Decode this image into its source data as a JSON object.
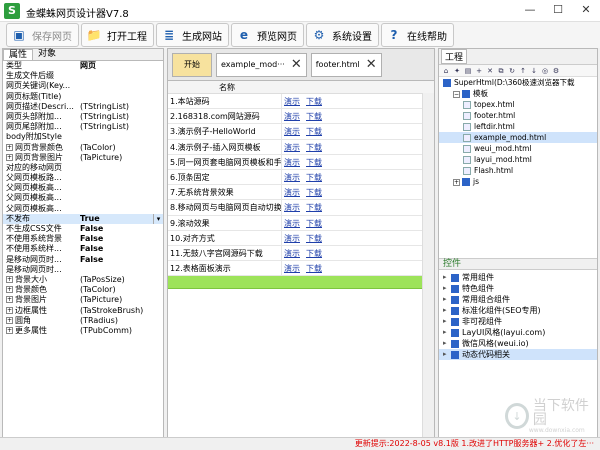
{
  "window": {
    "logo": "S",
    "title": "金蝶蛛网页设计器V7.8"
  },
  "toolbar": [
    {
      "label": "保存网页",
      "icon": "save-icon",
      "disabled": true
    },
    {
      "label": "打开工程",
      "icon": "open-folder-icon"
    },
    {
      "label": "生成网站",
      "icon": "stack-icon"
    },
    {
      "label": "预览网页",
      "icon": "ie-icon"
    },
    {
      "label": "系统设置",
      "icon": "gear-icon"
    },
    {
      "label": "在线帮助",
      "icon": "help-icon"
    }
  ],
  "left": {
    "tabs": [
      "属性",
      "对象"
    ],
    "props": [
      {
        "n": "类型",
        "v": "网页",
        "b": true
      },
      {
        "n": "生成文件后缀",
        "v": ""
      },
      {
        "n": "网页关键词(Key...",
        "v": ""
      },
      {
        "n": "网页标题(Title)",
        "v": ""
      },
      {
        "n": "网页描述(Descri...",
        "v": "(TStringList)"
      },
      {
        "n": "网页头部附加...",
        "v": "(TStringList)"
      },
      {
        "n": "网页尾部附加...",
        "v": "(TStringList)"
      },
      {
        "n": "body附加Style",
        "v": ""
      },
      {
        "n": "网页背景颜色",
        "v": "(TaColor)",
        "e": true
      },
      {
        "n": "网页背景图片",
        "v": "(TaPicture)",
        "e": true
      },
      {
        "n": "对应的移动网页",
        "v": ""
      },
      {
        "n": "父网页模板路...",
        "v": ""
      },
      {
        "n": "父网页模板高...",
        "v": ""
      },
      {
        "n": "父网页模板高...",
        "v": ""
      },
      {
        "n": "父网页模板高...",
        "v": ""
      },
      {
        "n": "不发布",
        "v": "True",
        "b": true,
        "sel": true,
        "dd": true
      },
      {
        "n": "不生成CSS文件",
        "v": "False",
        "b": true
      },
      {
        "n": "不使用系统背景",
        "v": "False",
        "b": true
      },
      {
        "n": "不使用系统样...",
        "v": "False",
        "b": true
      },
      {
        "n": "是移动网页时...",
        "v": "False",
        "b": true
      },
      {
        "n": "是移动网页时...",
        "v": ""
      },
      {
        "n": "背景大小",
        "v": "(TaPosSize)",
        "e": true
      },
      {
        "n": "背景颜色",
        "v": "(TaColor)",
        "e": true
      },
      {
        "n": "背景图片",
        "v": "(TaPicture)",
        "e": true
      },
      {
        "n": "边框属性",
        "v": "(TaStrokeBrush)",
        "e": true
      },
      {
        "n": "圆角",
        "v": "(TRadius)",
        "e": true
      },
      {
        "n": "更多属性",
        "v": "(TPubComm)",
        "e": true
      }
    ]
  },
  "mid": {
    "tabs": [
      "开始",
      "example_mod···",
      "footer.html"
    ],
    "col_name": "名称",
    "link1": "演示",
    "link2": "下载",
    "rows": [
      "1.本站源码",
      "2.168318.com网站源码",
      "3.演示例子-HelloWorld",
      "4.演示例子-插入网页模板",
      "5.同一网页套电脑网页模板和手",
      "6.顶条固定",
      "7.无系统背景效果",
      "8.移动网页与电脑网页自动切换",
      "9.滚动效果",
      "10.对齐方式",
      "11.无鼓八字宫网源码下载",
      "12.表格面板演示"
    ]
  },
  "right": {
    "title": "工程",
    "tree": [
      {
        "t": "SuperHtml(D:\\360极速浏览器下载",
        "lvl": 0,
        "k": "root"
      },
      {
        "t": "模板",
        "lvl": 1,
        "k": "folder",
        "exp": "−"
      },
      {
        "t": "topex.html",
        "lvl": 2,
        "k": "file"
      },
      {
        "t": "footer.html",
        "lvl": 2,
        "k": "file"
      },
      {
        "t": "leftdir.html",
        "lvl": 2,
        "k": "file"
      },
      {
        "t": "example_mod.html",
        "lvl": 2,
        "k": "file",
        "sel": true
      },
      {
        "t": "weui_mod.html",
        "lvl": 2,
        "k": "file"
      },
      {
        "t": "layui_mod.html",
        "lvl": 2,
        "k": "file"
      },
      {
        "t": "Flash.html",
        "lvl": 2,
        "k": "file"
      },
      {
        "t": "js",
        "lvl": 1,
        "k": "folder",
        "exp": "+"
      }
    ],
    "ctrl_title": "控件",
    "controls": [
      {
        "t": "常用组件"
      },
      {
        "t": "特色组件"
      },
      {
        "t": "常用组合组件"
      },
      {
        "t": "标准化组件(SEO专用)"
      },
      {
        "t": "非可视组件"
      },
      {
        "t": "LayUI风格(layui.com)"
      },
      {
        "t": "微信风格(weui.io)"
      },
      {
        "t": "动态代码相关",
        "sel": true
      }
    ]
  },
  "status": "更新提示:2022-8-05 v8.1版 1.改进了HTTP服务器+ 2.优化了左···",
  "watermark": {
    "title": "当下软件园",
    "sub": "www.downxia.com"
  }
}
